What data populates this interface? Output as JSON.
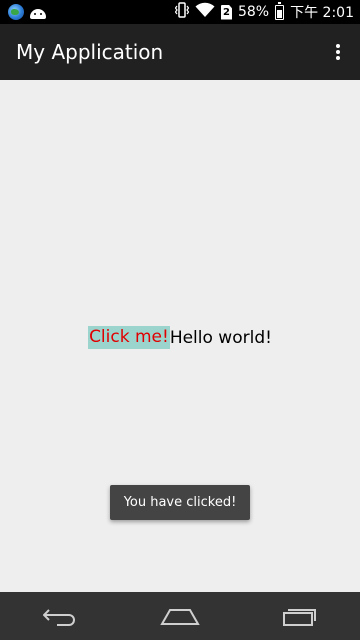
{
  "status_bar": {
    "battery": "58%",
    "time": "下午 2:01",
    "icons": [
      "globe-icon",
      "android-icon",
      "vibrate-icon",
      "wifi-icon",
      "sim-icon",
      "battery-icon"
    ]
  },
  "action_bar": {
    "title": "My Application",
    "overflow_icon": "overflow-menu-icon"
  },
  "main": {
    "click_button_label": "Click me!",
    "hello_text": "Hello world!"
  },
  "toast": {
    "message": "You have clicked!"
  },
  "nav_bar": {
    "icons": [
      "back-icon",
      "home-icon",
      "recents-icon"
    ]
  },
  "colors": {
    "status_bar": "#000000",
    "action_bar": "#212121",
    "background": "#eeeeee",
    "button_bg": "#9bd3cd",
    "button_text": "#e00000",
    "toast_bg": "#444444",
    "nav_bar": "#333333"
  }
}
